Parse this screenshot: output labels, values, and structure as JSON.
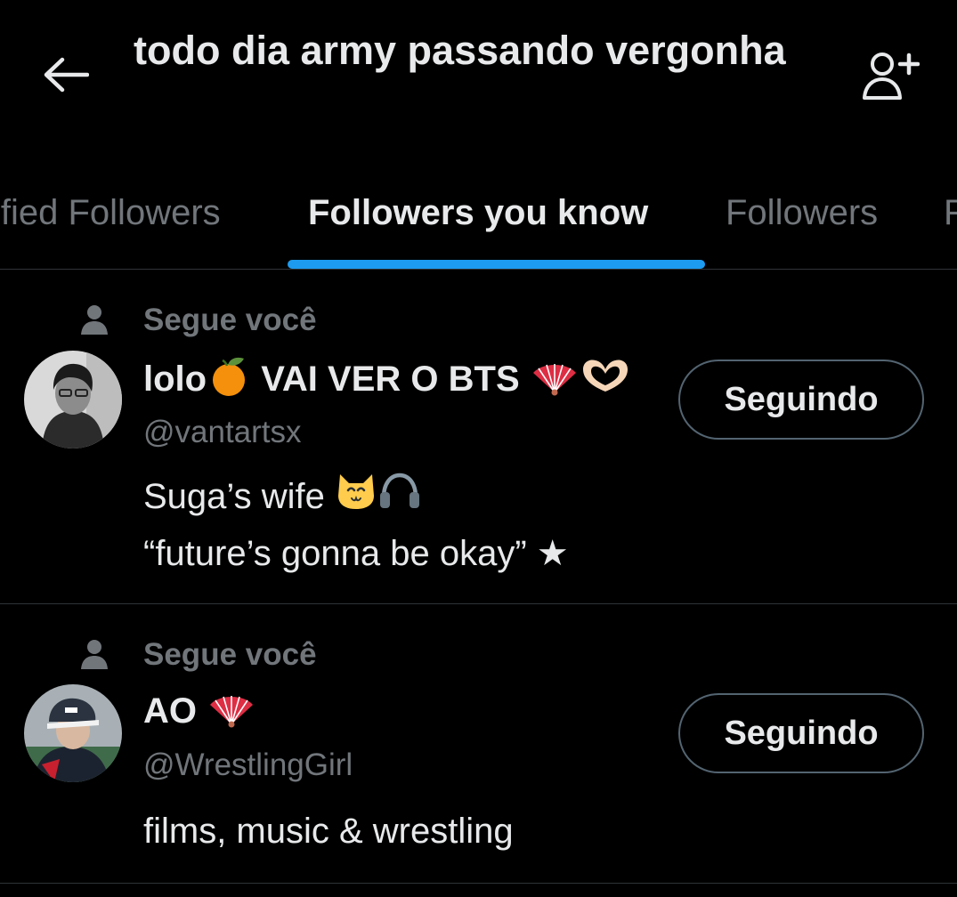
{
  "header": {
    "title": "todo dia army passando vergonha",
    "back_icon": "arrow-left-icon",
    "follow_icon": "person-add-icon"
  },
  "tabs": [
    {
      "label": "ified Followers",
      "active": false
    },
    {
      "label": "Followers you know",
      "active": true
    },
    {
      "label": "Followers",
      "active": false
    },
    {
      "label": "F",
      "active": false
    }
  ],
  "colors": {
    "background": "#000000",
    "text_primary": "#e7e9ea",
    "text_secondary": "#71767b",
    "accent": "#1d9bf0",
    "divider": "#2f3336"
  },
  "users": [
    {
      "context": "Segue você",
      "display_name": "lolo",
      "display_name_rest": " VAI VER O BTS ",
      "handle": "@vantartsx",
      "bio_line1": "Suga’s wife ",
      "bio_line2": "“future’s gonna be okay” ★",
      "button_label": "Seguindo"
    },
    {
      "context": "Segue você",
      "display_name": "AO ",
      "handle": "@WrestlingGirl",
      "bio_line1": "films, music & wrestling",
      "button_label": "Seguindo"
    }
  ]
}
